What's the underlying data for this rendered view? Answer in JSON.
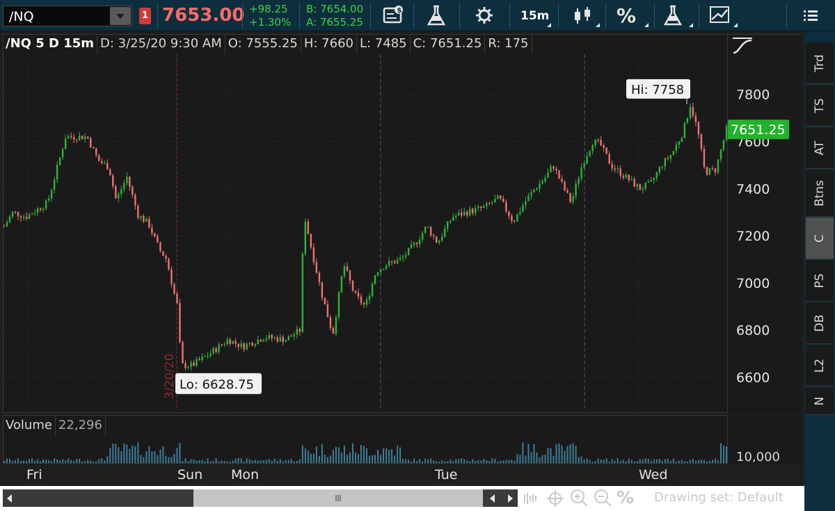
{
  "toolbar": {
    "symbol": "/NQ",
    "badge": "1",
    "last": "7653.00",
    "net_change": "+98.25",
    "pct_change": "+1.30%",
    "bid": "B: 7654.00",
    "ask": "A: 7655.25",
    "timeframe": "15m",
    "percent_glyph": "%"
  },
  "header": {
    "symbol_period": "/NQ 5 D 15m",
    "date": "D: 3/25/20 9:30 AM",
    "open": "O: 7555.25",
    "high": "H: 7660",
    "low": "L: 7485",
    "close": "C: 7651.25",
    "range": "R: 175"
  },
  "annotations": {
    "hi": "Hi: 7758",
    "lo": "Lo: 6628.75",
    "current": "7651.25",
    "session_date": "3/20/20"
  },
  "price_axis": {
    "ticks": [
      6600,
      6800,
      7000,
      7200,
      7400,
      7600,
      7800
    ],
    "range": [
      6460,
      7970
    ]
  },
  "volume": {
    "label": "Volume",
    "value": "22,296",
    "tick": "10,000"
  },
  "time_axis": {
    "labels": [
      "Fri",
      "Sun",
      "Mon",
      "Tue",
      "Wed"
    ]
  },
  "bottom": {
    "drawing_set": "Drawing set: Default",
    "zoom_percent": "%"
  },
  "side_tabs": [
    "Trd",
    "TS",
    "AT",
    "Btns",
    "C",
    "PS",
    "DB",
    "L2",
    "N"
  ],
  "colors": {
    "up": "#2fb43a",
    "down": "#f07373",
    "accent_bg": "#0d2e3c",
    "last_price": "#ff6a6a",
    "current_tag": "#22b22c"
  },
  "chart_data": {
    "type": "candlestick",
    "price_ylim": [
      6460,
      7970
    ],
    "hi": 7758,
    "lo": 6628.75,
    "last_close": 7651.25,
    "path": [
      [
        0,
        7240
      ],
      [
        0.012,
        7300
      ],
      [
        0.03,
        7280
      ],
      [
        0.06,
        7340
      ],
      [
        0.07,
        7450
      ],
      [
        0.085,
        7620
      ],
      [
        0.115,
        7620
      ],
      [
        0.13,
        7520
      ],
      [
        0.145,
        7490
      ],
      [
        0.155,
        7350
      ],
      [
        0.17,
        7450
      ],
      [
        0.185,
        7290
      ],
      [
        0.2,
        7250
      ],
      [
        0.215,
        7140
      ],
      [
        0.225,
        7100
      ],
      [
        0.235,
        6960
      ],
      [
        0.24,
        6900
      ],
      [
        0.245,
        6650
      ],
      [
        0.26,
        6650
      ],
      [
        0.285,
        6700
      ],
      [
        0.31,
        6760
      ],
      [
        0.33,
        6730
      ],
      [
        0.36,
        6770
      ],
      [
        0.39,
        6760
      ],
      [
        0.41,
        6800
      ],
      [
        0.415,
        7300
      ],
      [
        0.425,
        7150
      ],
      [
        0.44,
        6950
      ],
      [
        0.455,
        6780
      ],
      [
        0.47,
        7080
      ],
      [
        0.485,
        6950
      ],
      [
        0.5,
        6900
      ],
      [
        0.515,
        7050
      ],
      [
        0.53,
        7080
      ],
      [
        0.55,
        7100
      ],
      [
        0.57,
        7170
      ],
      [
        0.585,
        7240
      ],
      [
        0.6,
        7170
      ],
      [
        0.62,
        7280
      ],
      [
        0.64,
        7300
      ],
      [
        0.665,
        7320
      ],
      [
        0.685,
        7360
      ],
      [
        0.695,
        7310
      ],
      [
        0.705,
        7260
      ],
      [
        0.72,
        7340
      ],
      [
        0.735,
        7400
      ],
      [
        0.75,
        7450
      ],
      [
        0.76,
        7500
      ],
      [
        0.775,
        7400
      ],
      [
        0.785,
        7340
      ],
      [
        0.8,
        7500
      ],
      [
        0.815,
        7600
      ],
      [
        0.825,
        7590
      ],
      [
        0.84,
        7500
      ],
      [
        0.86,
        7450
      ],
      [
        0.88,
        7400
      ],
      [
        0.895,
        7420
      ],
      [
        0.91,
        7500
      ],
      [
        0.925,
        7550
      ],
      [
        0.94,
        7640
      ],
      [
        0.95,
        7758
      ],
      [
        0.96,
        7650
      ],
      [
        0.97,
        7470
      ],
      [
        0.985,
        7480
      ],
      [
        1.0,
        7651
      ]
    ]
  }
}
